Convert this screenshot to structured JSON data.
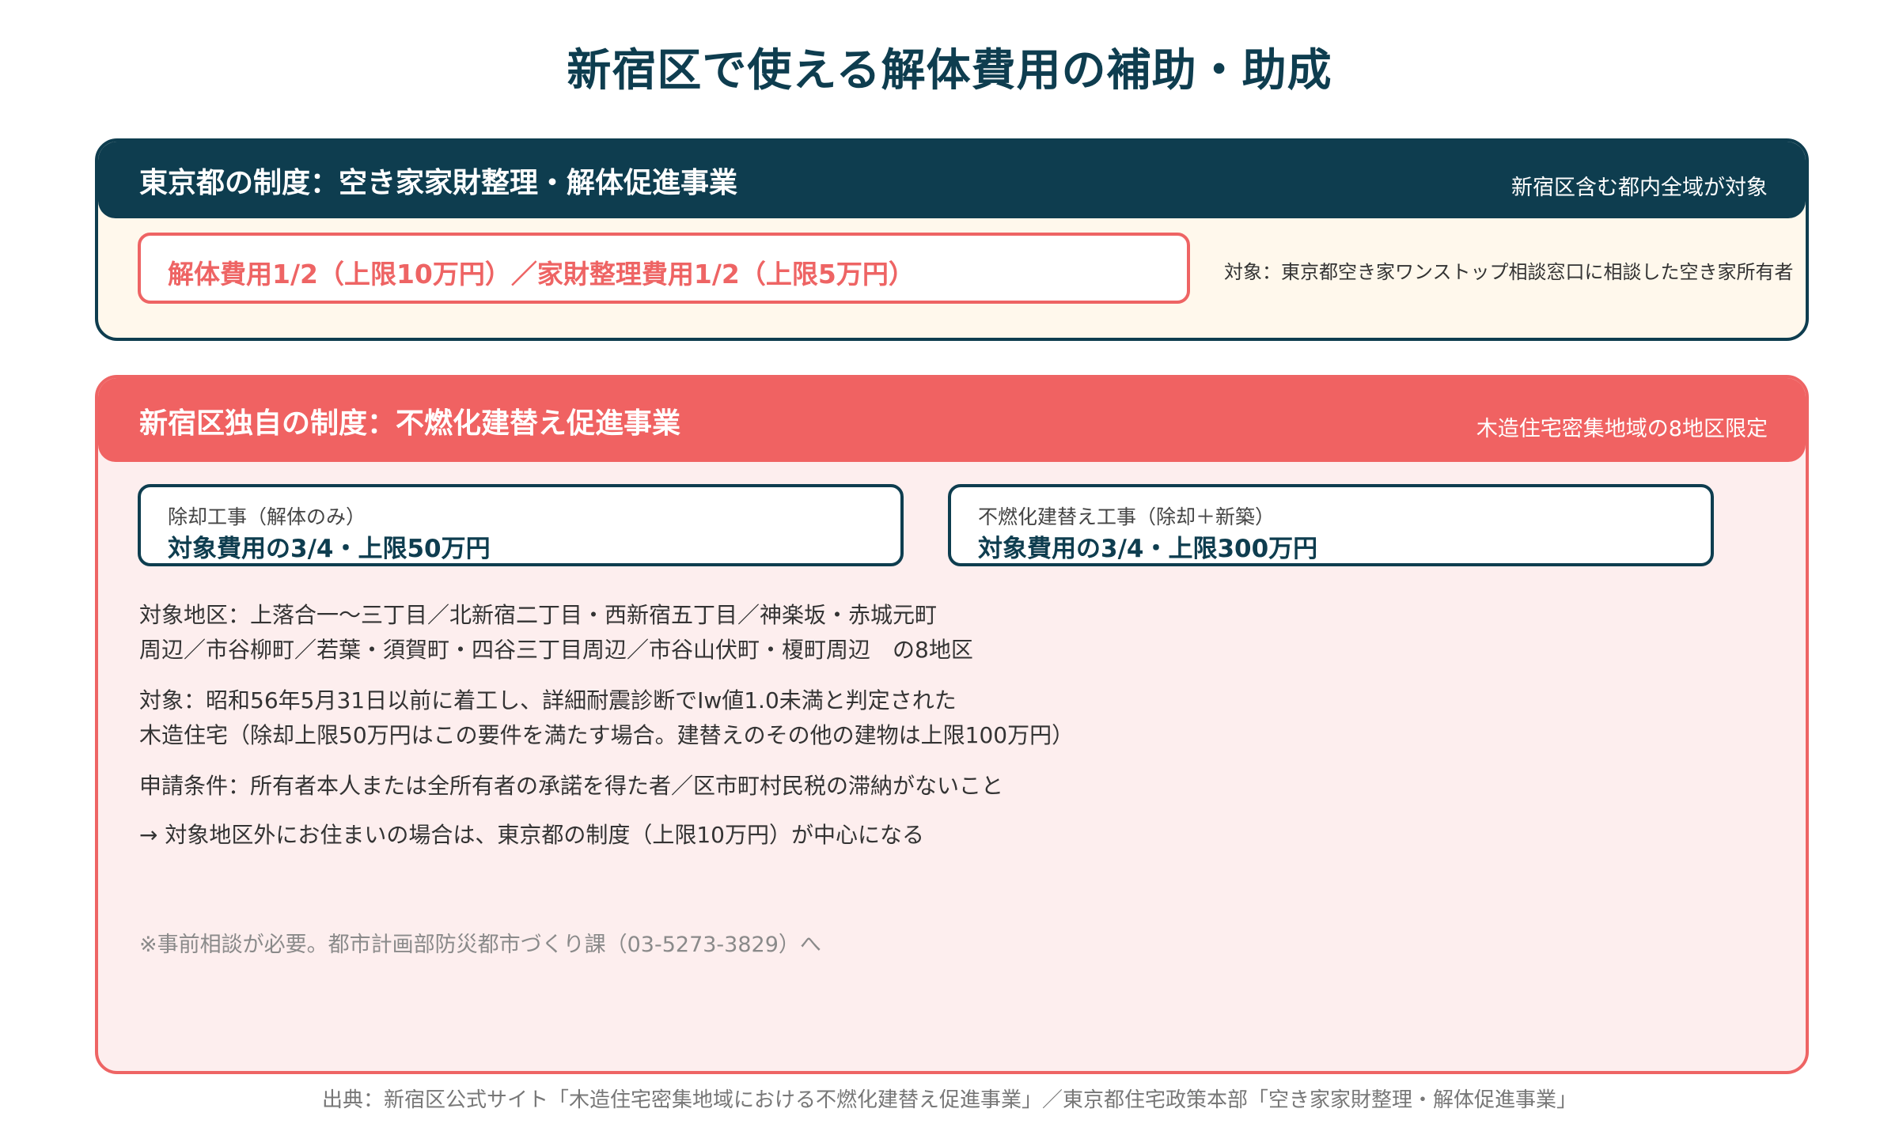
{
  "title": "新宿区で使える解体費用の補助・助成",
  "tokyo": {
    "heading": "東京都の制度：空き家家財整理・解体促進事業",
    "scope_note": "新宿区含む都内全域が対象",
    "highlight": "解体費用1/2（上限10万円）／家財整理費用1/2（上限5万円）",
    "target": "対象：東京都空き家ワンストップ相談窓口に相談した空き家所有者"
  },
  "shinjuku": {
    "heading": "新宿区独自の制度：不燃化建替え促進事業",
    "scope_note": "木造住宅密集地域の8地区限定",
    "boxes": [
      {
        "small": "除却工事（解体のみ）",
        "big": "対象費用の3/4・上限50万円"
      },
      {
        "small": "不燃化建替え工事（除却＋新築）",
        "big": "対象費用の3/4・上限300万円"
      }
    ],
    "areas_line1": "対象地区：上落合一〜三丁目／北新宿二丁目・西新宿五丁目／神楽坂・赤城元町",
    "areas_line2": "周辺／市谷柳町／若葉・須賀町・四谷三丁目周辺／市谷山伏町・榎町周辺　の8地区",
    "target_line1": "対象：昭和56年5月31日以前に着工し、詳細耐震診断でIw値1.0未満と判定された",
    "target_line2": "木造住宅（除却上限50万円はこの要件を満たす場合。建替えのその他の建物は上限100万円）",
    "conditions": "申請条件：所有者本人または全所有者の承諾を得た者／区市町村民税の滞納がないこと",
    "note": "→ 対象地区外にお住まいの場合は、東京都の制度（上限10万円）が中心になる",
    "consult": "※事前相談が必要。都市計画部防災都市づくり課（03-5273-3829）へ"
  },
  "source": "出典：新宿区公式サイト「木造住宅密集地域における不燃化建替え促進事業」／東京都住宅政策本部「空き家家財整理・解体促進事業」",
  "colors": {
    "navy": "#0e3d4f",
    "coral": "#f06262",
    "cream": "#fff8ec",
    "pink": "#fdeeee"
  }
}
